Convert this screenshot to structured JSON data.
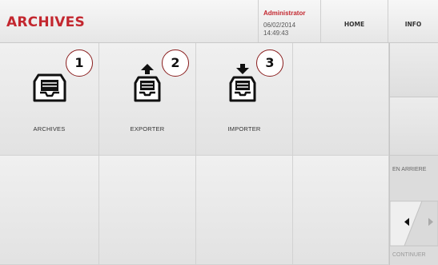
{
  "header": {
    "title": "ARCHIVES",
    "user": {
      "name": "Administrator",
      "date": "06/02/2014",
      "time": "14:49:43"
    },
    "nav": {
      "home_label": "HOME",
      "info_label": "INFO"
    }
  },
  "tiles": [
    {
      "label": "ARCHIVES",
      "badge": "1",
      "icon": "archive-tray-icon"
    },
    {
      "label": "EXPORTER",
      "badge": "2",
      "icon": "export-tray-icon"
    },
    {
      "label": "IMPORTER",
      "badge": "3",
      "icon": "import-tray-icon"
    }
  ],
  "side_panel": {
    "back_label": "EN ARRIERE",
    "continue_label": "CONTINUER"
  },
  "colors": {
    "accent": "#c3272f",
    "badge_border": "#8a1d1d",
    "tile_bg": "#e8e8e8"
  }
}
